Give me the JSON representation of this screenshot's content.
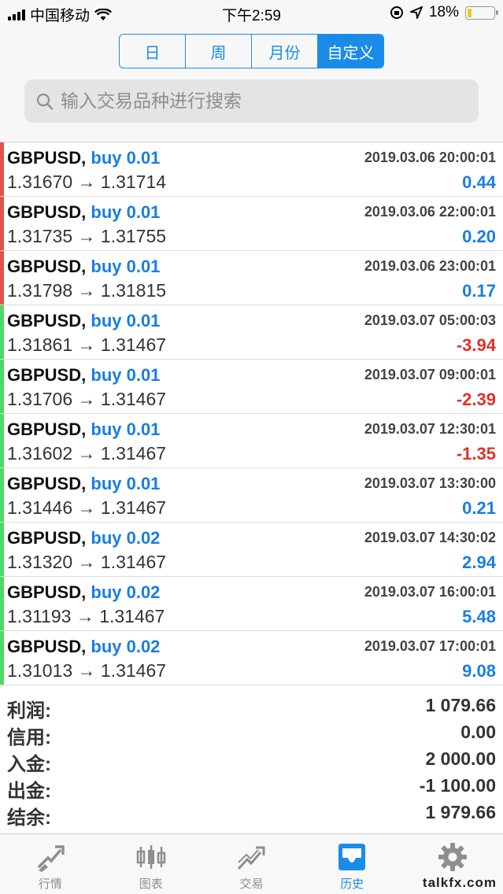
{
  "status_bar": {
    "carrier": "中国移动",
    "time": "下午2:59",
    "battery_percent": "18%",
    "battery_level": 0.18
  },
  "segment": {
    "tabs": [
      {
        "label": "日",
        "active": false
      },
      {
        "label": "周",
        "active": false
      },
      {
        "label": "月份",
        "active": false
      },
      {
        "label": "自定义",
        "active": true
      }
    ]
  },
  "search": {
    "placeholder": "输入交易品种进行搜索"
  },
  "trades": [
    {
      "symbol": "GBPUSD,",
      "side": "buy 0.01",
      "time": "2019.03.06 20:00:01",
      "prices": "1.31670 → 1.31714",
      "profit": "0.44",
      "negative": false,
      "bar_color": "#e0524a"
    },
    {
      "symbol": "GBPUSD,",
      "side": "buy 0.01",
      "time": "2019.03.06 22:00:01",
      "prices": "1.31735 → 1.31755",
      "profit": "0.20",
      "negative": false,
      "bar_color": "#e0524a"
    },
    {
      "symbol": "GBPUSD,",
      "side": "buy 0.01",
      "time": "2019.03.06 23:00:01",
      "prices": "1.31798 → 1.31815",
      "profit": "0.17",
      "negative": false,
      "bar_color": "#e0524a"
    },
    {
      "symbol": "GBPUSD,",
      "side": "buy 0.01",
      "time": "2019.03.07 05:00:03",
      "prices": "1.31861 → 1.31467",
      "profit": "-3.94",
      "negative": true,
      "bar_color": "#4cd964"
    },
    {
      "symbol": "GBPUSD,",
      "side": "buy 0.01",
      "time": "2019.03.07 09:00:01",
      "prices": "1.31706 → 1.31467",
      "profit": "-2.39",
      "negative": true,
      "bar_color": "#4cd964"
    },
    {
      "symbol": "GBPUSD,",
      "side": "buy 0.01",
      "time": "2019.03.07 12:30:01",
      "prices": "1.31602 → 1.31467",
      "profit": "-1.35",
      "negative": true,
      "bar_color": "#4cd964"
    },
    {
      "symbol": "GBPUSD,",
      "side": "buy 0.01",
      "time": "2019.03.07 13:30:00",
      "prices": "1.31446 → 1.31467",
      "profit": "0.21",
      "negative": false,
      "bar_color": "#4cd964"
    },
    {
      "symbol": "GBPUSD,",
      "side": "buy 0.02",
      "time": "2019.03.07 14:30:02",
      "prices": "1.31320 → 1.31467",
      "profit": "2.94",
      "negative": false,
      "bar_color": "#4cd964"
    },
    {
      "symbol": "GBPUSD,",
      "side": "buy 0.02",
      "time": "2019.03.07 16:00:01",
      "prices": "1.31193 → 1.31467",
      "profit": "5.48",
      "negative": false,
      "bar_color": "#4cd964"
    },
    {
      "symbol": "GBPUSD,",
      "side": "buy 0.02",
      "time": "2019.03.07 17:00:01",
      "prices": "1.31013 → 1.31467",
      "profit": "9.08",
      "negative": false,
      "bar_color": "#4cd964"
    }
  ],
  "summary": [
    {
      "label": "利润:",
      "value": "1 079.66"
    },
    {
      "label": "信用:",
      "value": "0.00"
    },
    {
      "label": "入金:",
      "value": "2 000.00"
    },
    {
      "label": "出金:",
      "value": "-1 100.00"
    },
    {
      "label": "结余:",
      "value": "1 979.66"
    }
  ],
  "tabbar": [
    {
      "label": "行情",
      "icon": "quotes-icon",
      "active": false
    },
    {
      "label": "图表",
      "icon": "chart-icon",
      "active": false
    },
    {
      "label": "交易",
      "icon": "trade-icon",
      "active": false
    },
    {
      "label": "历史",
      "icon": "history-icon",
      "active": true
    },
    {
      "label": "设置",
      "icon": "gear-icon",
      "active": false
    }
  ],
  "watermark": "talkfx.com",
  "colors": {
    "accent": "#1a8ce8",
    "positive": "#1a7ee0",
    "negative": "#e0322a"
  }
}
